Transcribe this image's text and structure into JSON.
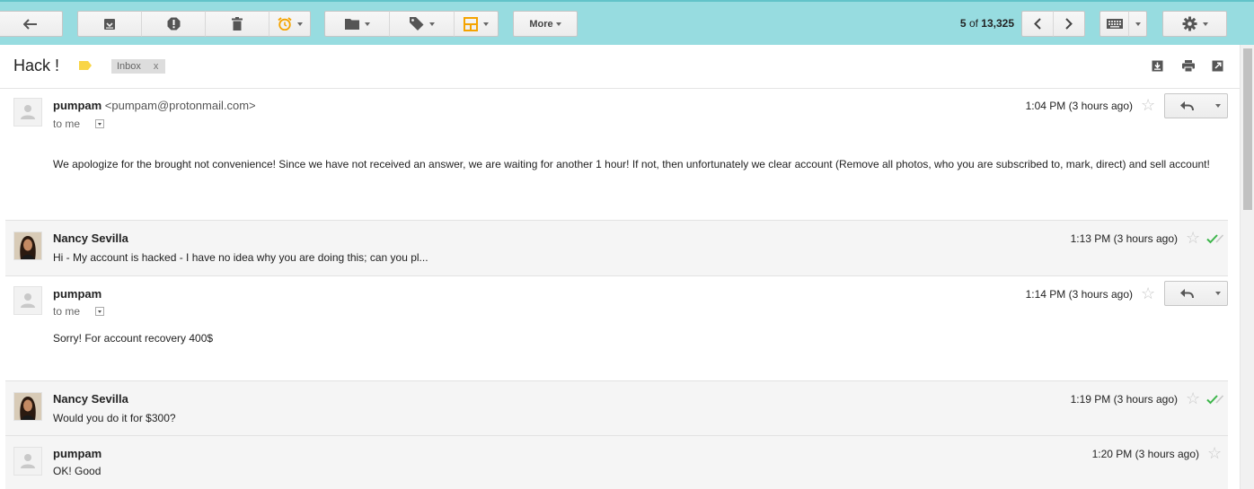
{
  "toolbar": {
    "more_label": "More",
    "pager_range": "5",
    "pager_of": "of",
    "pager_total": "13,325",
    "icons": [
      "back-arrow-icon",
      "archive-icon",
      "report-spam-icon",
      "delete-icon",
      "snooze-icon",
      "move-to-folder-icon",
      "label-icon",
      "layout-icon",
      "more-caret-icon",
      "newer-icon",
      "older-icon",
      "keyboard-icon",
      "gear-icon"
    ],
    "snooze_color": "#f4a300",
    "layout_color": "#f4a300"
  },
  "thread": {
    "subject": "Hack !",
    "label_color": "#f9d546",
    "inbox_chip": "Inbox",
    "inbox_chip_remove": "x"
  },
  "messages": [
    {
      "sender": "pumpam",
      "email": "<pumpam@protonmail.com>",
      "to": "to me",
      "time": "1:04 PM (3 hours ago)",
      "body": "We apologize for the brought not convenience! Since we have not received an answer, we are waiting for another 1 hour! If not, then unfortunately we clear account (Remove all photos, who you are subscribed to, mark, direct) and sell account!"
    },
    {
      "sender": "Nancy Sevilla",
      "time": "1:13 PM (3 hours ago)",
      "snippet": "Hi - My account is hacked - I have no idea why you are doing this; can you pl..."
    },
    {
      "sender": "pumpam",
      "to": "to me",
      "time": "1:14 PM (3 hours ago)",
      "body": "Sorry! For account recovery 400$"
    },
    {
      "sender": "Nancy Sevilla",
      "time": "1:19 PM (3 hours ago)",
      "snippet": "Would you do it for $300?"
    },
    {
      "sender": "pumpam",
      "time": "1:20 PM (3 hours ago)",
      "snippet": "OK! Good"
    }
  ],
  "colors": {
    "toolbar_bg": "#97dce0",
    "read_check": "#3cb54a"
  }
}
